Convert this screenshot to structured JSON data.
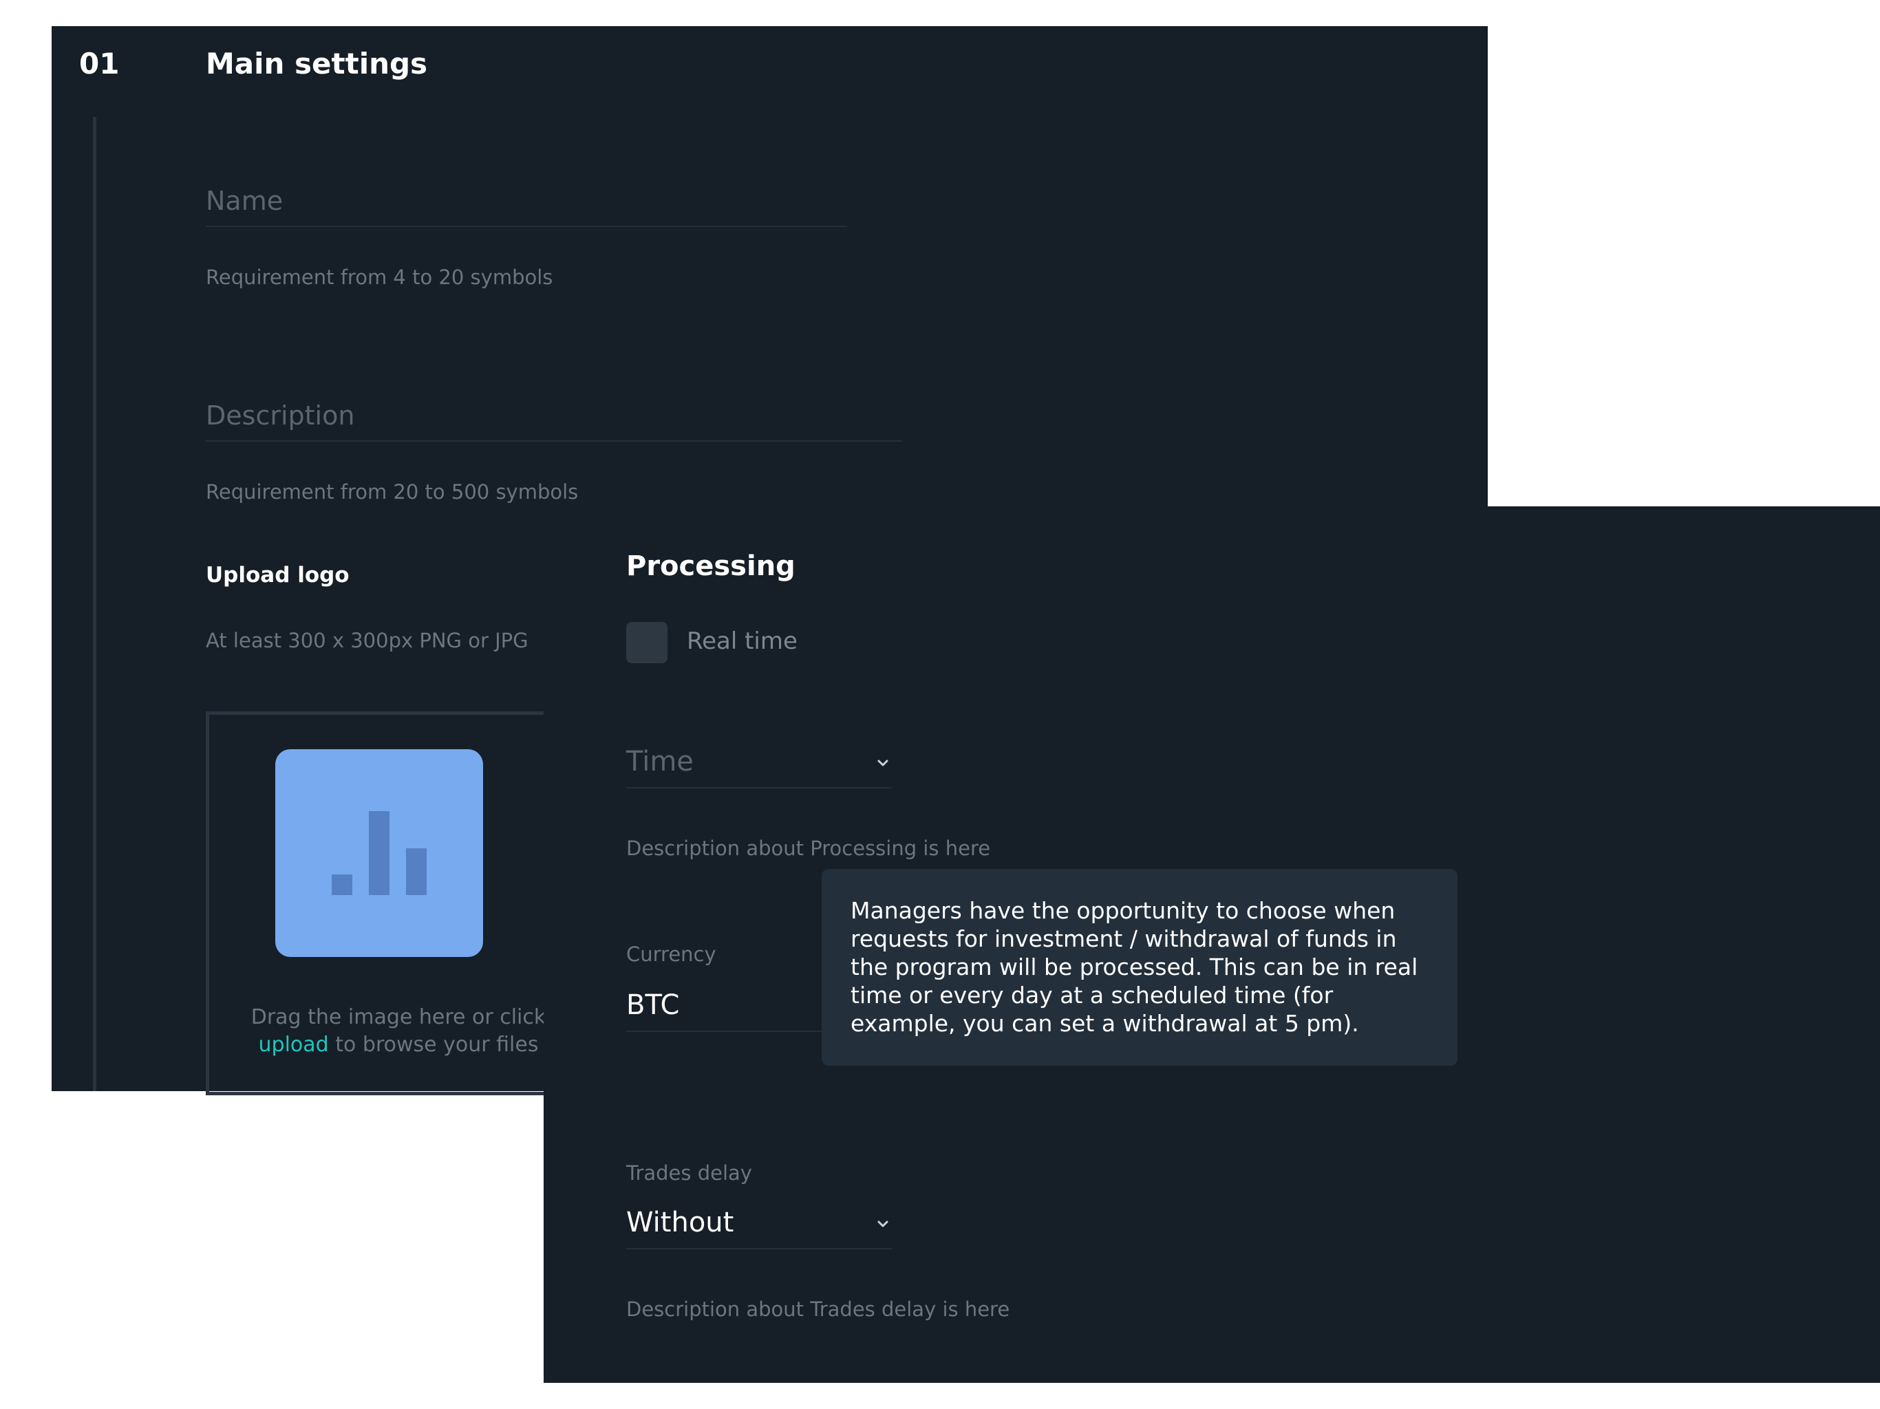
{
  "main_settings": {
    "step_number": "01",
    "title": "Main settings",
    "name_field": {
      "placeholder": "Name",
      "hint": "Requirement from 4 to 20 symbols"
    },
    "description_field": {
      "placeholder": "Description",
      "hint": "Requirement from 20 to 500 symbols"
    },
    "upload": {
      "title": "Upload logo",
      "hint": "At least 300 x 300px PNG or JPG",
      "drop_text_before": "Drag the image here or click",
      "drop_link": "upload",
      "drop_text_after": "to browse your files",
      "icon": "bar-chart-icon"
    }
  },
  "processing": {
    "title": "Processing",
    "realtime_checkbox": {
      "label": "Real time",
      "checked": false
    },
    "time_select": {
      "placeholder": "Time",
      "icon": "chevron-down-icon"
    },
    "time_hint": "Description about Processing is here",
    "currency": {
      "label": "Currency",
      "value": "BTC"
    },
    "tooltip": "Managers have the opportunity to choose when requests for investment / withdrawal of funds in the program will be processed. This can be in real time or every day at a scheduled time (for example, you can set a withdrawal at 5 pm).",
    "trades_delay": {
      "label": "Trades delay",
      "value": "Without",
      "icon": "chevron-down-icon"
    },
    "trades_delay_hint": "Description about Trades delay is here"
  },
  "colors": {
    "background": "#161e27",
    "accent_link": "#1ec7c0",
    "logo_tile": "#78aaef",
    "tooltip_bg": "#232f3b"
  }
}
